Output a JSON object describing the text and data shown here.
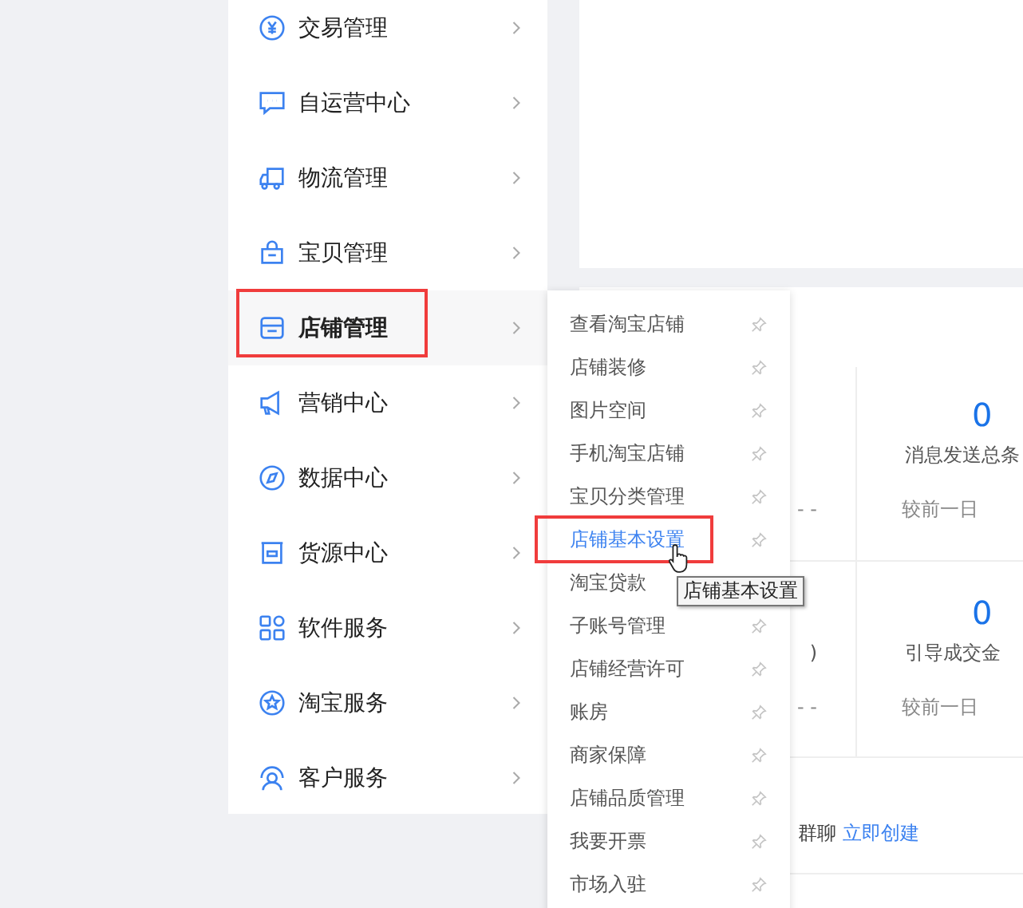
{
  "sidebar": {
    "items": [
      {
        "label": "交易管理",
        "selected": false,
        "highlighted": false
      },
      {
        "label": "自运营中心",
        "selected": false,
        "highlighted": false
      },
      {
        "label": "物流管理",
        "selected": false,
        "highlighted": false
      },
      {
        "label": "宝贝管理",
        "selected": false,
        "highlighted": false
      },
      {
        "label": "店铺管理",
        "selected": true,
        "highlighted": true
      },
      {
        "label": "营销中心",
        "selected": false,
        "highlighted": false
      },
      {
        "label": "数据中心",
        "selected": false,
        "highlighted": false
      },
      {
        "label": "货源中心",
        "selected": false,
        "highlighted": false
      },
      {
        "label": "软件服务",
        "selected": false,
        "highlighted": false
      },
      {
        "label": "淘宝服务",
        "selected": false,
        "highlighted": false
      },
      {
        "label": "客户服务",
        "selected": false,
        "highlighted": false
      }
    ]
  },
  "submenu": {
    "items": [
      {
        "label": "查看淘宝店铺",
        "selected": false,
        "highlighted": false,
        "pin": true
      },
      {
        "label": "店铺装修",
        "selected": false,
        "highlighted": false,
        "pin": true
      },
      {
        "label": "图片空间",
        "selected": false,
        "highlighted": false,
        "pin": true
      },
      {
        "label": "手机淘宝店铺",
        "selected": false,
        "highlighted": false,
        "pin": true
      },
      {
        "label": "宝贝分类管理",
        "selected": false,
        "highlighted": false,
        "pin": true
      },
      {
        "label": "店铺基本设置",
        "selected": true,
        "highlighted": true,
        "pin": true
      },
      {
        "label": "淘宝贷款",
        "selected": false,
        "highlighted": false,
        "pin": false
      },
      {
        "label": "子账号管理",
        "selected": false,
        "highlighted": false,
        "pin": true
      },
      {
        "label": "店铺经营许可",
        "selected": false,
        "highlighted": false,
        "pin": true
      },
      {
        "label": "账房",
        "selected": false,
        "highlighted": false,
        "pin": true
      },
      {
        "label": "商家保障",
        "selected": false,
        "highlighted": false,
        "pin": true
      },
      {
        "label": "店铺品质管理",
        "selected": false,
        "highlighted": false,
        "pin": true
      },
      {
        "label": "我要开票",
        "selected": false,
        "highlighted": false,
        "pin": true
      },
      {
        "label": "市场入驻",
        "selected": false,
        "highlighted": false,
        "pin": true
      }
    ],
    "tooltip": "店铺基本设置"
  },
  "stats": {
    "rows": [
      {
        "left": {
          "compare": "- -"
        },
        "right": {
          "value": "0",
          "label": "消息发送总条",
          "compare": "较前一日"
        }
      },
      {
        "left": {
          "label": ")",
          "compare": "- -"
        },
        "right": {
          "value": "0",
          "label": "引导成交金",
          "compare": "较前一日"
        }
      }
    ]
  },
  "group_chat": {
    "text": "群聊",
    "link": "立即创建"
  }
}
